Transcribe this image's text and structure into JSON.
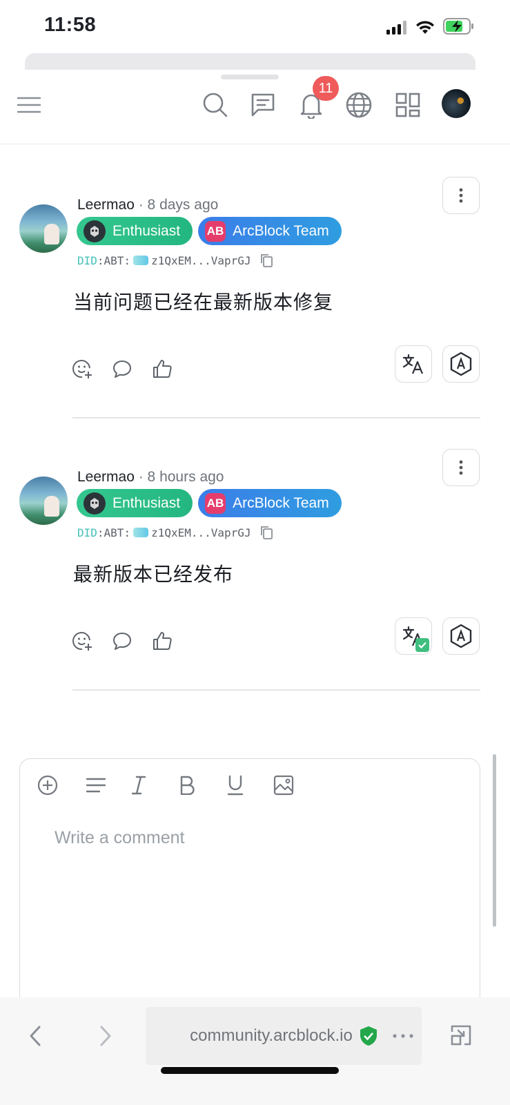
{
  "status": {
    "time": "11:58"
  },
  "header": {
    "notification_count": "11"
  },
  "comments": [
    {
      "author": "Leermao",
      "time": "· 8 days ago",
      "badges": [
        {
          "label": "Enthusiast",
          "icon": "owl-icon"
        },
        {
          "label": "ArcBlock Team",
          "icon": "AB"
        }
      ],
      "did_prefix": "DID",
      "did_chain": ":ABT:",
      "did_value": "z1QxEM...VaprGJ",
      "text": "当前问题已经在最新版本修复",
      "translated": false
    },
    {
      "author": "Leermao",
      "time": "· 8 hours ago",
      "badges": [
        {
          "label": "Enthusiast",
          "icon": "owl-icon"
        },
        {
          "label": "ArcBlock Team",
          "icon": "AB"
        }
      ],
      "did_prefix": "DID",
      "did_chain": ":ABT:",
      "did_value": "z1QxEM...VaprGJ",
      "text": "最新版本已经发布",
      "translated": true
    }
  ],
  "editor": {
    "placeholder": "Write a comment"
  },
  "browser": {
    "url": "community.arcblock.io"
  },
  "colors": {
    "accent_green": "#23b681",
    "accent_blue": "#2f8ee6",
    "badge_red": "#ef5b5b"
  }
}
